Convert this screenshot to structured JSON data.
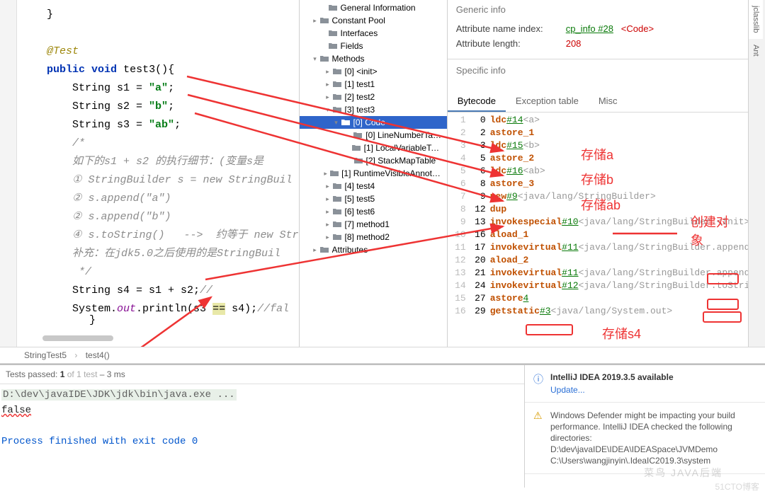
{
  "code": {
    "ann": "@Test",
    "sig": {
      "pub": "public",
      "void": "void",
      "name": " test3(){"
    },
    "s1": {
      "decl": "String s1 = ",
      "val": "\"a\"",
      "end": ";"
    },
    "s2": {
      "decl": "String s2 = ",
      "val": "\"b\"",
      "end": ";"
    },
    "s3": {
      "decl": "String s3 = ",
      "val": "\"ab\"",
      "end": ";"
    },
    "c0": "/*",
    "c1": "如下的s1 + s2 的执行细节：(变量s是",
    "c2": "① StringBuilder s = new StringBuil",
    "c3": "② s.append(\"a\")",
    "c4": "② s.append(\"b\")",
    "c5": "④ s.toString()   -->  约等于 new Str",
    "c6": "补充：在jdk5.0之后使用的是StringBuil",
    "c7": " */",
    "s4": {
      "decl": "String s4 = s1 + s2;",
      "cmt": "//"
    },
    "print": {
      "pre": "System.",
      "out": "out",
      "call": ".println(s3 ",
      "eq": "==",
      "post": " s4);",
      "cmt": "//fal"
    },
    "close": "}"
  },
  "tree": {
    "items": [
      {
        "indent": 24,
        "arrow": "",
        "label": "General Information"
      },
      {
        "indent": 12,
        "arrow": "▸",
        "label": "Constant Pool"
      },
      {
        "indent": 24,
        "arrow": "",
        "label": "Interfaces"
      },
      {
        "indent": 24,
        "arrow": "",
        "label": "Fields"
      },
      {
        "indent": 12,
        "arrow": "▾",
        "label": "Methods"
      },
      {
        "indent": 30,
        "arrow": "▸",
        "label": "[0] <init>"
      },
      {
        "indent": 30,
        "arrow": "▸",
        "label": "[1] test1"
      },
      {
        "indent": 30,
        "arrow": "▸",
        "label": "[2] test2"
      },
      {
        "indent": 30,
        "arrow": "▾",
        "label": "[3] test3"
      },
      {
        "indent": 42,
        "arrow": "▾",
        "label": "[0] Code",
        "selected": true
      },
      {
        "indent": 60,
        "arrow": "",
        "label": "[0] LineNumberTable"
      },
      {
        "indent": 60,
        "arrow": "",
        "label": "[1] LocalVariableTable"
      },
      {
        "indent": 60,
        "arrow": "",
        "label": "[2] StackMapTable"
      },
      {
        "indent": 30,
        "arrow": "▸",
        "label": "[1] RuntimeVisibleAnnotatio..."
      },
      {
        "indent": 30,
        "arrow": "▸",
        "label": "[4] test4"
      },
      {
        "indent": 30,
        "arrow": "▸",
        "label": "[5] test5"
      },
      {
        "indent": 30,
        "arrow": "▸",
        "label": "[6] test6"
      },
      {
        "indent": 30,
        "arrow": "▸",
        "label": "[7] method1"
      },
      {
        "indent": 30,
        "arrow": "▸",
        "label": "[8] method2"
      },
      {
        "indent": 12,
        "arrow": "▸",
        "label": "Attributes"
      }
    ]
  },
  "right": {
    "generic_title": "Generic info",
    "attr_name_label": "Attribute name index:",
    "attr_name_link": "cp_info #28",
    "attr_name_extra": "<Code>",
    "attr_len_label": "Attribute length:",
    "attr_len_val": "208",
    "specific_title": "Specific info",
    "tabs": {
      "bytecode": "Bytecode",
      "exception": "Exception table",
      "misc": "Misc"
    },
    "bytecode": [
      {
        "ln": "1",
        "off": "0",
        "op": "ldc",
        "link": "#14",
        "extra": "<a>"
      },
      {
        "ln": "2",
        "off": "2",
        "op": "astore_1",
        "link": "",
        "extra": ""
      },
      {
        "ln": "3",
        "off": "3",
        "op": "ldc",
        "link": "#15",
        "extra": "<b>"
      },
      {
        "ln": "4",
        "off": "5",
        "op": "astore_2",
        "link": "",
        "extra": ""
      },
      {
        "ln": "5",
        "off": "6",
        "op": "ldc",
        "link": "#16",
        "extra": "<ab>"
      },
      {
        "ln": "6",
        "off": "8",
        "op": "astore_3",
        "link": "",
        "extra": ""
      },
      {
        "ln": "7",
        "off": "9",
        "op": "new",
        "link": "#9",
        "extra": "<java/lang/StringBuilder>"
      },
      {
        "ln": "8",
        "off": "12",
        "op": "dup",
        "link": "",
        "extra": ""
      },
      {
        "ln": "9",
        "off": "13",
        "op": "invokespecial",
        "link": "#10",
        "extra": "<java/lang/StringBuilder.<init>>"
      },
      {
        "ln": "10",
        "off": "16",
        "op": "aload_1",
        "link": "",
        "extra": ""
      },
      {
        "ln": "11",
        "off": "17",
        "op": "invokevirtual",
        "link": "#11",
        "extra": "<java/lang/StringBuilder.append>"
      },
      {
        "ln": "12",
        "off": "20",
        "op": "aload_2",
        "link": "",
        "extra": ""
      },
      {
        "ln": "13",
        "off": "21",
        "op": "invokevirtual",
        "link": "#11",
        "extra": "<java/lang/StringBuilder.append>"
      },
      {
        "ln": "14",
        "off": "24",
        "op": "invokevirtual",
        "link": "#12",
        "extra": "<java/lang/StringBuilder.toString"
      },
      {
        "ln": "15",
        "off": "27",
        "op": "astore ",
        "link": "4",
        "extra": ""
      },
      {
        "ln": "16",
        "off": "29",
        "op": "getstatic",
        "link": "#3",
        "extra": "<java/lang/System.out>"
      }
    ]
  },
  "annotations": {
    "a1": "存储a",
    "a2": "存储b",
    "a3": "存储ab",
    "a4": "创建对象",
    "a5": "存储s4"
  },
  "breadcrumb": {
    "file": "StringTest5",
    "method": "test4()"
  },
  "tests": {
    "status_prefix": "Tests passed: ",
    "passed": "1",
    "total": " of 1 test",
    "time": " – 3 ms"
  },
  "console": {
    "cmd": "D:\\dev\\javaIDE\\JDK\\jdk\\bin\\java.exe ...",
    "out": "false",
    "exit": "Process finished with exit code 0"
  },
  "notifications": {
    "update": {
      "title": "IntelliJ IDEA 2019.3.5 available",
      "link": "Update..."
    },
    "defender": {
      "title": "",
      "text": "Windows Defender might be impacting your build performance. IntelliJ IDEA checked the following directories:",
      "paths": "D:\\dev\\javaIDE\\IDEA\\IDEASpace\\JVMDemo\nC:\\Users\\wangjinyin\\.IdeaIC2019.3\\system"
    }
  },
  "side": {
    "ant": "Ant"
  },
  "watermark": "菜鸟 JAVA后端",
  "watermark2": "51CTO博客"
}
